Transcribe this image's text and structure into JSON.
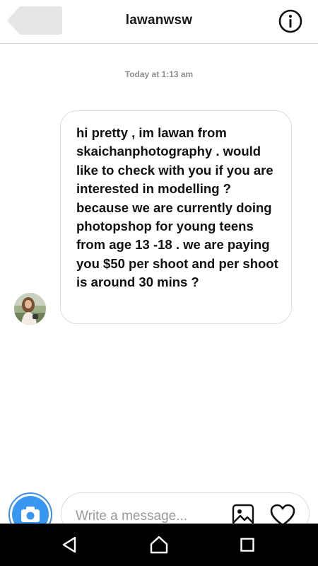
{
  "header": {
    "title": "lawanwsw",
    "back_icon": "back-arrow-icon",
    "info_icon": "info-icon"
  },
  "conversation": {
    "timestamp": "Today at 1:13 am",
    "messages": [
      {
        "sender": "lawanwsw",
        "text": "hi pretty , im lawan from skaichanphotography . would like to check with you if you are interested in modelling ? because we are currently doing photopshop for young teens from age 13 -18 . we are paying you $50 per shoot and per shoot is around 30 mins ?"
      }
    ]
  },
  "composer": {
    "placeholder": "Write a message...",
    "value": "",
    "camera_icon": "camera-icon",
    "gallery_icon": "gallery-icon",
    "heart_icon": "heart-icon"
  },
  "navbar": {
    "back_icon": "nav-back-icon",
    "home_icon": "nav-home-icon",
    "recent_icon": "nav-recent-apps-icon"
  },
  "colors": {
    "accent": "#3897f0",
    "border": "#dcdcdc",
    "timestamp": "#8e8e8e",
    "navbar": "#000000"
  }
}
